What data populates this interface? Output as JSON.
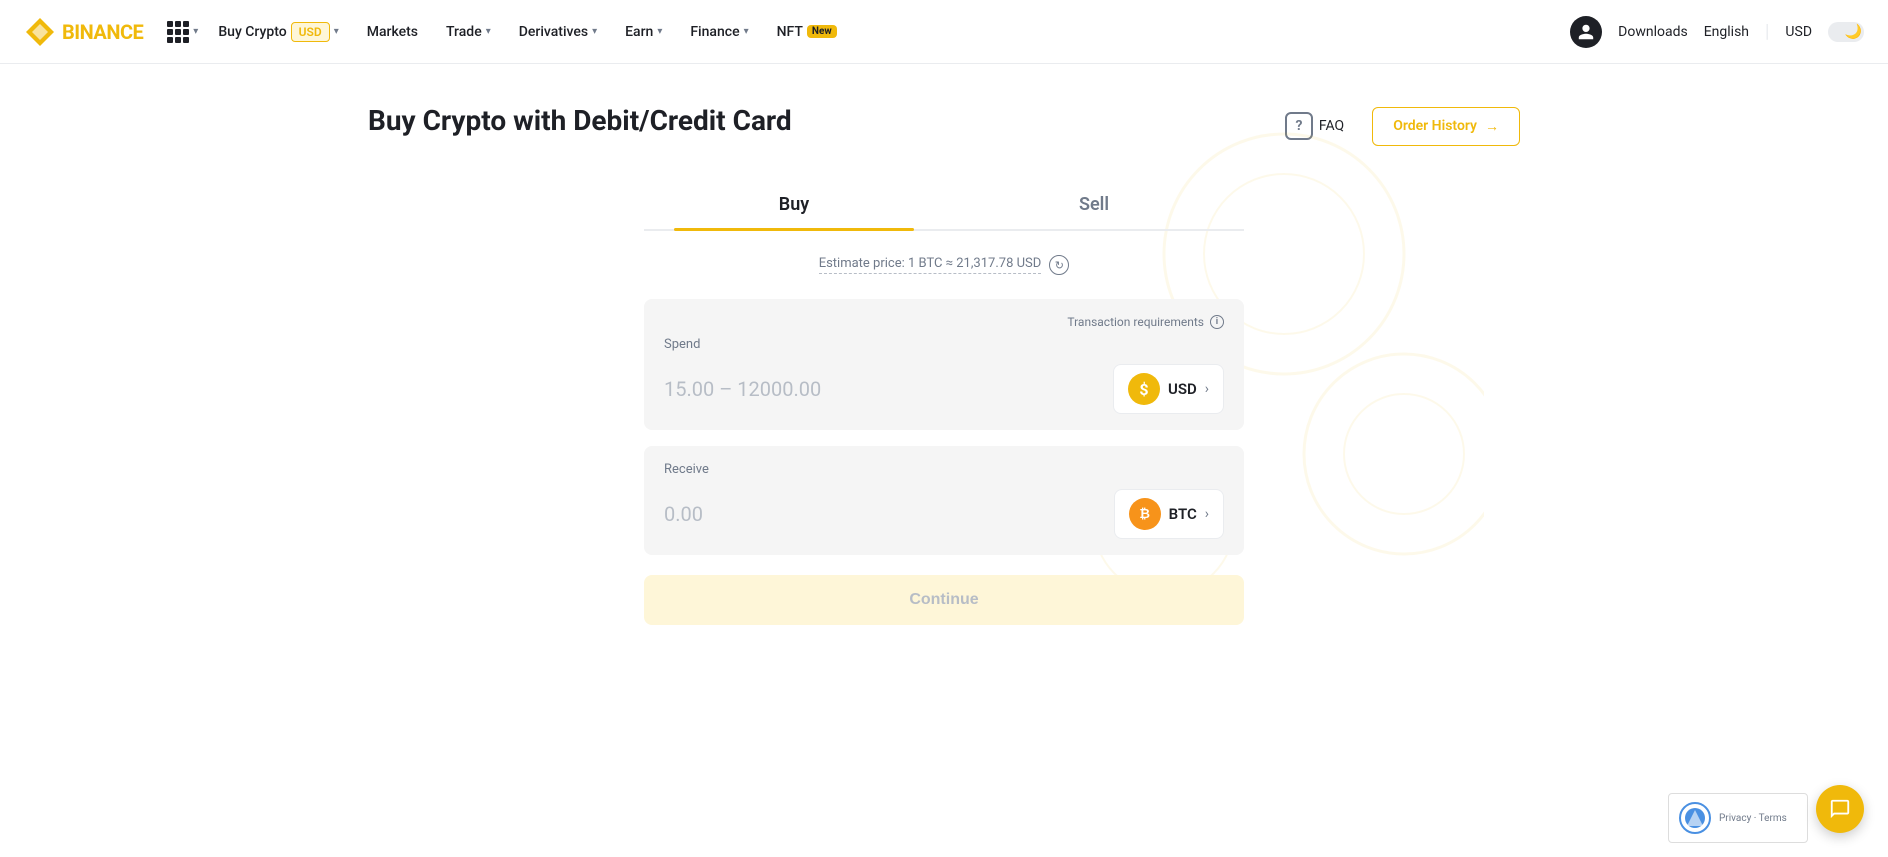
{
  "brand": {
    "name": "BINANCE",
    "logo_alt": "Binance logo"
  },
  "nav": {
    "buy_crypto_label": "Buy Crypto",
    "buy_crypto_badge": "USD",
    "markets_label": "Markets",
    "trade_label": "Trade",
    "derivatives_label": "Derivatives",
    "earn_label": "Earn",
    "finance_label": "Finance",
    "nft_label": "NFT",
    "nft_badge": "New",
    "downloads_label": "Downloads",
    "english_label": "English",
    "usd_label": "USD"
  },
  "page": {
    "title": "Buy Crypto with Debit/Credit Card",
    "faq_label": "FAQ",
    "faq_icon": "?",
    "order_history_label": "Order History",
    "order_history_arrow": "→"
  },
  "tabs": [
    {
      "label": "Buy",
      "active": true
    },
    {
      "label": "Sell",
      "active": false
    }
  ],
  "estimate": {
    "text": "Estimate price: 1 BTC ≈ 21,317.78 USD"
  },
  "spend": {
    "label": "Spend",
    "placeholder": "15.00 – 12000.00",
    "transaction_req_label": "Transaction requirements",
    "currency_name": "USD"
  },
  "receive": {
    "label": "Receive",
    "value": "0.00",
    "currency_name": "BTC"
  },
  "continue_btn": {
    "label": "Continue"
  },
  "chat_widget": {
    "title": "Chat support"
  },
  "recaptcha": {
    "text": "Privacy · Terms"
  }
}
